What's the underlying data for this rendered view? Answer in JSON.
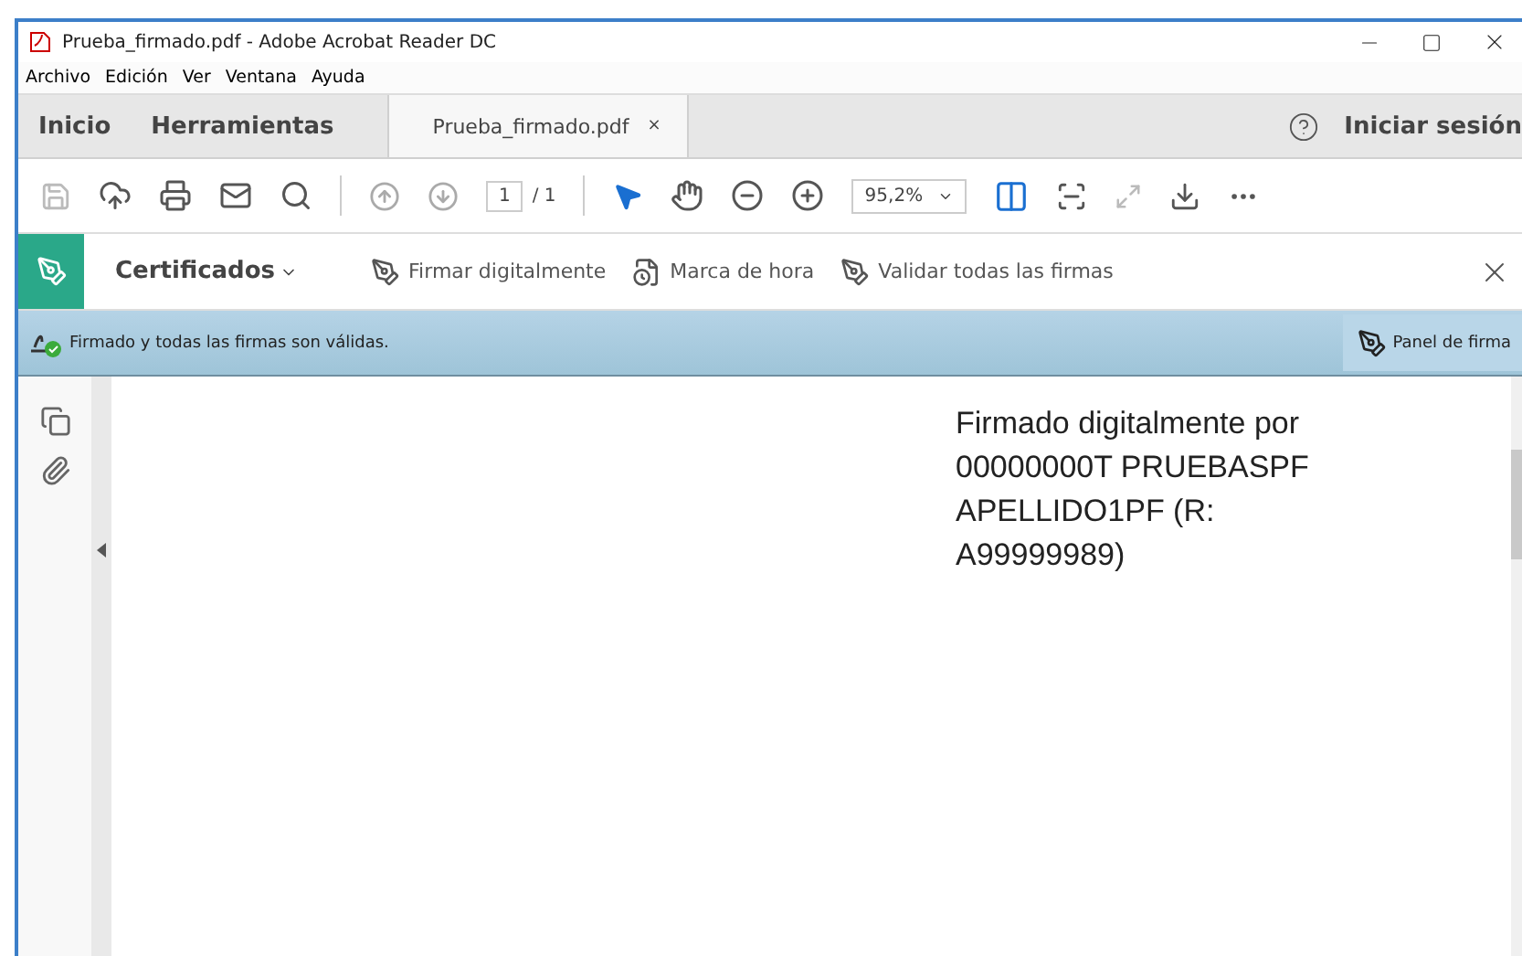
{
  "window": {
    "title": "Prueba_firmado.pdf - Adobe Acrobat Reader DC"
  },
  "menu": [
    "Archivo",
    "Edición",
    "Ver",
    "Ventana",
    "Ayuda"
  ],
  "tabs": [
    {
      "label": "Inicio",
      "kind": "nav",
      "selected": false
    },
    {
      "label": "Herramientas",
      "kind": "nav",
      "selected": false
    },
    {
      "label": "Prueba_firmado.pdf",
      "kind": "doc",
      "selected": true,
      "close": "×"
    }
  ],
  "sign_in": "Iniciar sesión",
  "toolbar": {
    "page": "1",
    "page_total": "/ 1",
    "zoom": "95,2%"
  },
  "cert_bar": {
    "title": "Certificados",
    "actions": [
      {
        "label": "Firmar digitalmente",
        "kind": "sign"
      },
      {
        "label": "Marca de hora",
        "kind": "timestamp"
      },
      {
        "label": "Validar todas las firmas",
        "kind": "validate"
      }
    ]
  },
  "status": {
    "message": "Firmado y todas las firmas son válidas.",
    "panel_button": "Panel de firma"
  },
  "document": {
    "lines": [
      "Firmado digitalmente por",
      "00000000T PRUEBASPF",
      "APELLIDO1PF (R:",
      "A99999989)"
    ]
  }
}
